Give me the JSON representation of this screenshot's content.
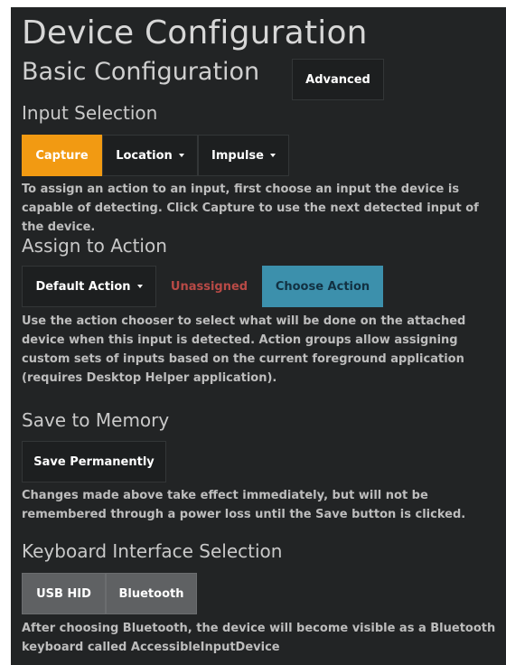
{
  "page": {
    "title": "Device Configuration",
    "subtitle": "Basic Configuration",
    "advanced_label": "Advanced"
  },
  "input_selection": {
    "heading": "Input Selection",
    "capture_label": "Capture",
    "location_label": "Location",
    "impulse_label": "Impulse",
    "description": "To assign an action to an input, first choose an input the device is capable of detecting. Click Capture to use the next detected input of the device."
  },
  "assign_action": {
    "heading": "Assign to Action",
    "default_action_label": "Default Action",
    "status_label": "Unassigned",
    "choose_action_label": "Choose Action",
    "description": "Use the action chooser to select what will be done on the attached device when this input is detected. Action groups allow assigning custom sets of inputs based on the current foreground application (requires Desktop Helper application)."
  },
  "save_memory": {
    "heading": "Save to Memory",
    "save_label": "Save Permanently",
    "description": "Changes made above take effect immediately, but will not be remembered through a power loss until the Save button is clicked."
  },
  "keyboard_interface": {
    "heading": "Keyboard Interface Selection",
    "usb_label": "USB HID",
    "bluetooth_label": "Bluetooth",
    "description": "After choosing Bluetooth, the device will become visible as a Bluetooth keyboard called AccessibleInputDevice"
  },
  "colors": {
    "background": "#222425",
    "capture_active": "#f29a12",
    "unassigned_text": "#b84a46",
    "choose_action": "#3c90ac",
    "keyboard_buttons": "#5f6163"
  }
}
